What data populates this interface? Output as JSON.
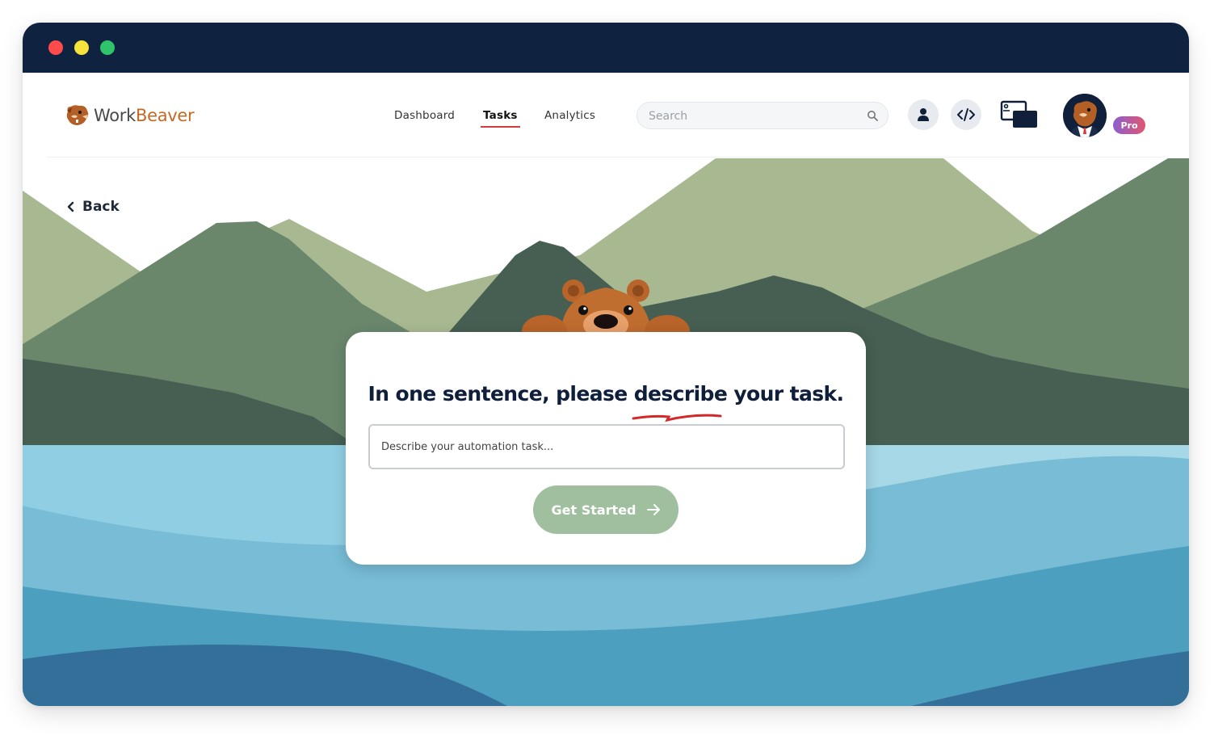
{
  "app": {
    "logo_word1": "Work",
    "logo_word2": "Beaver",
    "brand_color": "#c26a24"
  },
  "window_controls": {
    "close_color": "#ff4b4b",
    "minimize_color": "#f6e33b",
    "maximize_color": "#2fc46b",
    "titlebar_color": "#0f2240"
  },
  "nav": {
    "items": [
      {
        "label": "Dashboard",
        "active": false
      },
      {
        "label": "Tasks",
        "active": true
      },
      {
        "label": "Analytics",
        "active": false
      }
    ],
    "active_underline_color": "#d63a3a"
  },
  "search": {
    "placeholder": "Search",
    "icon": "search-icon"
  },
  "header_actions": {
    "profile_icon": "user-icon",
    "code_icon": "code-icon",
    "window_icon": "windows-icon",
    "avatar_icon": "beaver-avatar-icon",
    "badge": "Pro"
  },
  "back": {
    "label": "Back",
    "icon": "chevron-left-icon"
  },
  "card": {
    "title": "In one sentence, please describe your task.",
    "input_placeholder": "Describe your automation task...",
    "cta_label": "Get Started",
    "cta_icon": "arrow-right-icon",
    "cta_color": "#9fbf9e"
  },
  "palette": {
    "mountain_light": "#a8b991",
    "mountain_mid": "#6a876c",
    "mountain_dark": "#465f52",
    "water_light": "#90cfe3",
    "water_mid": "#78bcd6",
    "water_deep": "#4d9fc0",
    "water_darkest": "#336f99"
  }
}
